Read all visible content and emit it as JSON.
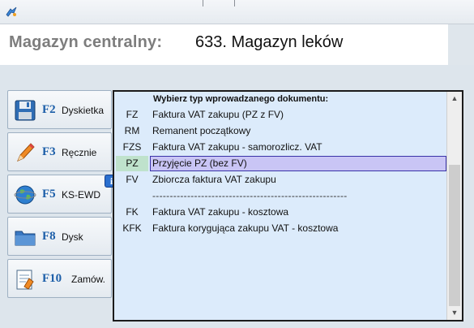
{
  "header": {
    "label": "Magazyn centralny:",
    "value": "633. Magazyn leków"
  },
  "sidebar": {
    "buttons": [
      {
        "key": "F2",
        "label": "Dyskietka",
        "icon": "floppy-disk-icon"
      },
      {
        "key": "F3",
        "label": "Ręcznie",
        "icon": "pencil-icon"
      },
      {
        "key": "F5",
        "label": "KS-EWD",
        "icon": "globe-icon",
        "badge": "i"
      },
      {
        "key": "F8",
        "label": "Dysk",
        "icon": "folder-icon"
      },
      {
        "key": "F10",
        "label": "Zamów.",
        "icon": "order-form-icon"
      }
    ]
  },
  "popup": {
    "title": "Wybierz typ wprowadzanego dokumentu:",
    "rows": [
      {
        "code": "FZ",
        "name": "Faktura VAT zakupu (PZ z FV)"
      },
      {
        "code": "RM",
        "name": "Remanent początkowy"
      },
      {
        "code": "FZS",
        "name": "Faktura VAT zakupu - samorozlicz. VAT"
      },
      {
        "code": "PZ",
        "name": "Przyjęcie PZ (bez FV)",
        "selected": true
      },
      {
        "code": "FV",
        "name": "Zbiorcza faktura VAT zakupu"
      },
      {
        "code": "",
        "name": "--------------------------------------------------------"
      },
      {
        "code": "FK",
        "name": "Faktura VAT zakupu - kosztowa"
      },
      {
        "code": "KFK",
        "name": "Faktura korygująca zakupu VAT - kosztowa"
      }
    ]
  },
  "colors": {
    "accent": "#1c5ea8",
    "selection": "#c9c5f5",
    "popup_bg": "#dcebfb"
  }
}
